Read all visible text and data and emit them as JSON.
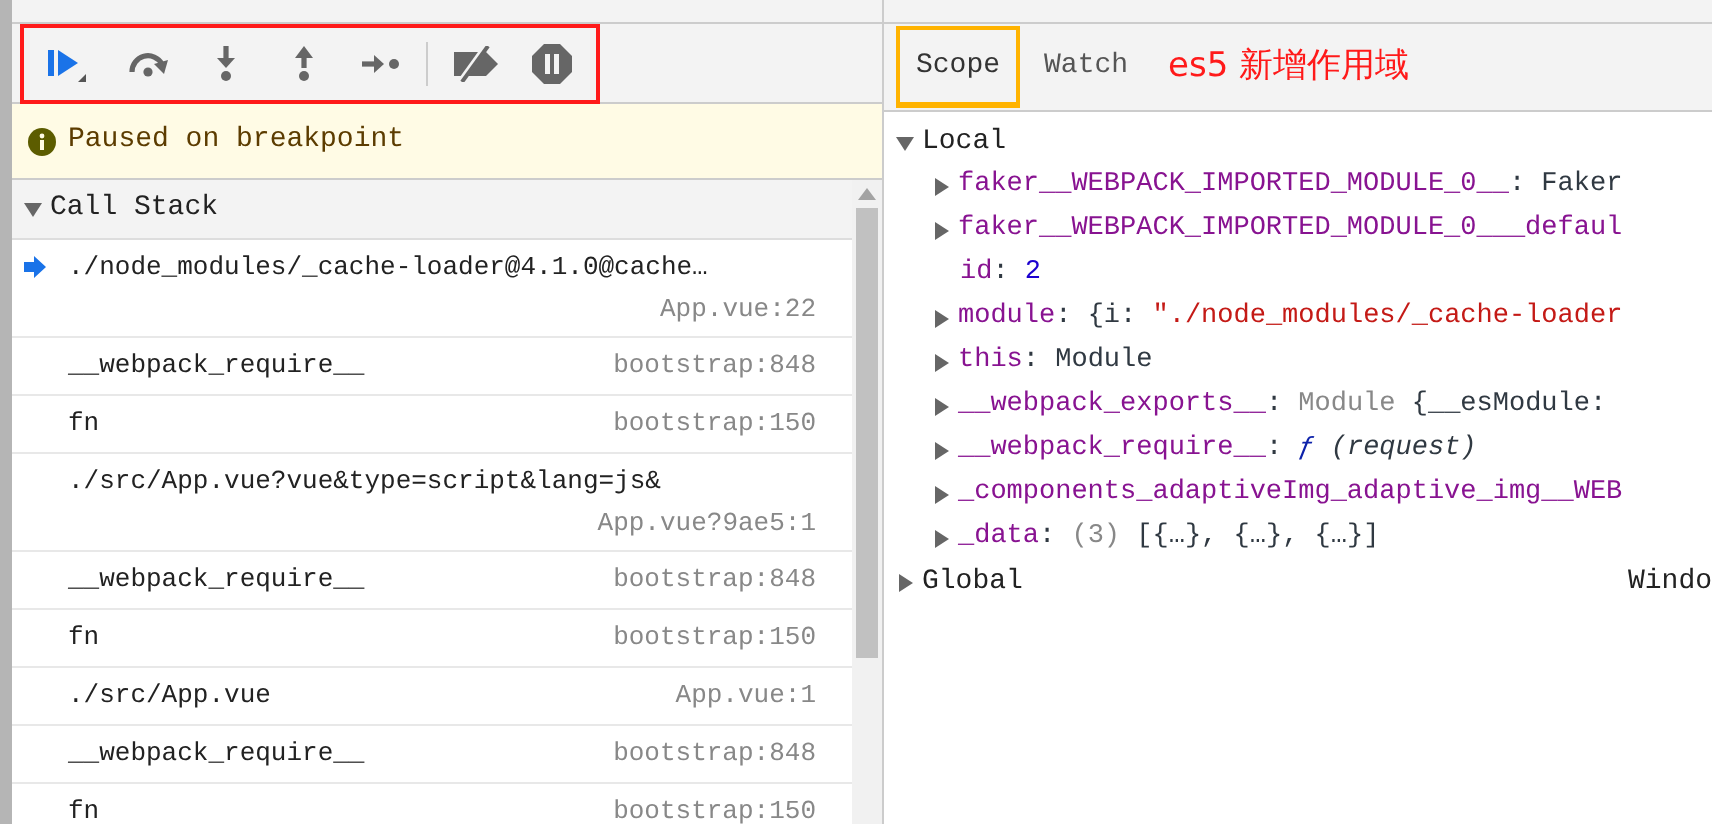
{
  "toolbar": {
    "outlined": true,
    "buttons": [
      {
        "kind": "resume"
      },
      {
        "kind": "step-over"
      },
      {
        "kind": "step-into"
      },
      {
        "kind": "step-out"
      },
      {
        "kind": "step"
      },
      {
        "kind": "deactivate"
      },
      {
        "kind": "pause-exceptions"
      }
    ]
  },
  "paused_banner": {
    "text": "Paused on breakpoint"
  },
  "call_stack": {
    "title": "Call Stack",
    "expanded": true,
    "frames": [
      {
        "name": "./node_modules/_cache-loader@4.1.0@cache…",
        "location": "App.vue:22",
        "selected": true
      },
      {
        "name": "__webpack_require__",
        "location": "bootstrap:848",
        "selected": false
      },
      {
        "name": "fn",
        "location": "bootstrap:150",
        "selected": false
      },
      {
        "name": "./src/App.vue?vue&type=script&lang=js&",
        "location": "App.vue?9ae5:1",
        "selected": false
      },
      {
        "name": "__webpack_require__",
        "location": "bootstrap:848",
        "selected": false
      },
      {
        "name": "fn",
        "location": "bootstrap:150",
        "selected": false
      },
      {
        "name": "./src/App.vue",
        "location": "App.vue:1",
        "selected": false
      },
      {
        "name": "__webpack_require__",
        "location": "bootstrap:848",
        "selected": false
      },
      {
        "name": "fn",
        "location": "bootstrap:150",
        "selected": false
      }
    ]
  },
  "tabs": [
    {
      "label": "Scope",
      "selected": true,
      "outlined": true
    },
    {
      "label": "Watch",
      "selected": false,
      "outlined": false
    }
  ],
  "annotation": {
    "text": "es5 新增作用域"
  },
  "scopes": [
    {
      "label": "Local",
      "expanded": true,
      "children": [
        {
          "name": "faker__WEBPACK_IMPORTED_MODULE_0__",
          "expandable": true,
          "parts": [
            {
              "text": ":",
              "kind": "plain"
            },
            {
              "text": "Faker",
              "kind": "plain"
            }
          ]
        },
        {
          "name": "faker__WEBPACK_IMPORTED_MODULE_0___defaul",
          "expandable": true
        },
        {
          "name": "id",
          "expandable": false,
          "parts": [
            {
              "text": ":",
              "kind": "plain"
            },
            {
              "text": "2",
              "kind": "number"
            }
          ]
        },
        {
          "name": "module",
          "expandable": true,
          "parts": [
            {
              "text": ":",
              "kind": "plain"
            },
            {
              "text": "{i:",
              "kind": "plain"
            },
            {
              "text": "\"./node_modules/_cache-loader",
              "kind": "string"
            }
          ]
        },
        {
          "name": "this",
          "expandable": true,
          "parts": [
            {
              "text": ":",
              "kind": "plain"
            },
            {
              "text": "Module",
              "kind": "plain"
            }
          ]
        },
        {
          "name": "__webpack_exports__",
          "expandable": true,
          "parts": [
            {
              "text": ":",
              "kind": "plain"
            },
            {
              "text": "Module",
              "kind": "dim"
            },
            {
              "text": "{__esModule:",
              "kind": "plain"
            }
          ]
        },
        {
          "name": "__webpack_require__",
          "expandable": true,
          "parts": [
            {
              "text": ":",
              "kind": "plain"
            },
            {
              "text": "ƒ",
              "kind": "function"
            },
            {
              "text": "(request)",
              "kind": "italic"
            }
          ]
        },
        {
          "name": "_components_adaptiveImg_adaptive_img__WEB",
          "expandable": true
        },
        {
          "name": "_data",
          "expandable": true,
          "parts": [
            {
              "text": ":",
              "kind": "plain"
            },
            {
              "text": "(3)",
              "kind": "dim"
            },
            {
              "text": "[{…}, {…}, {…}]",
              "kind": "plain"
            }
          ]
        }
      ]
    },
    {
      "label": "Global",
      "expanded": false,
      "value": "Windo"
    }
  ]
}
